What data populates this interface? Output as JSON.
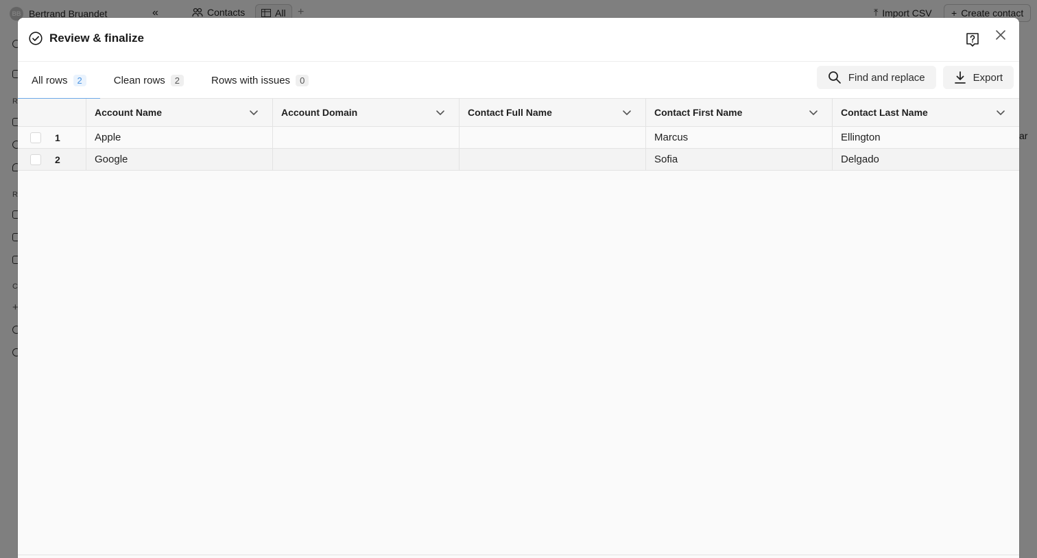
{
  "background": {
    "user_name": "Bertrand Bruandet",
    "user_initials": "BB",
    "tab_contacts": "Contacts",
    "tab_all": "All",
    "import_csv": "Import CSV",
    "create_contact": "Create contact",
    "sidebar_letters": [
      "R",
      "R",
      "C"
    ],
    "right_edge_text": "ar"
  },
  "modal": {
    "title": "Review & finalize",
    "tabs": [
      {
        "label": "All rows",
        "count": "2"
      },
      {
        "label": "Clean rows",
        "count": "2"
      },
      {
        "label": "Rows with issues",
        "count": "0"
      }
    ],
    "find_replace_label": "Find and replace",
    "export_label": "Export"
  },
  "table": {
    "columns": [
      "Account Name",
      "Account Domain",
      "Contact Full Name",
      "Contact First Name",
      "Contact Last Name"
    ],
    "rows": [
      {
        "num": "1",
        "cells": [
          "Apple",
          "",
          "",
          "Marcus",
          "Ellington"
        ]
      },
      {
        "num": "2",
        "cells": [
          "Google",
          "",
          "",
          "Sofia",
          "Delgado"
        ]
      }
    ]
  },
  "colors": {
    "accent": "#6aa7e8",
    "overlay": "#7d7d7d"
  }
}
